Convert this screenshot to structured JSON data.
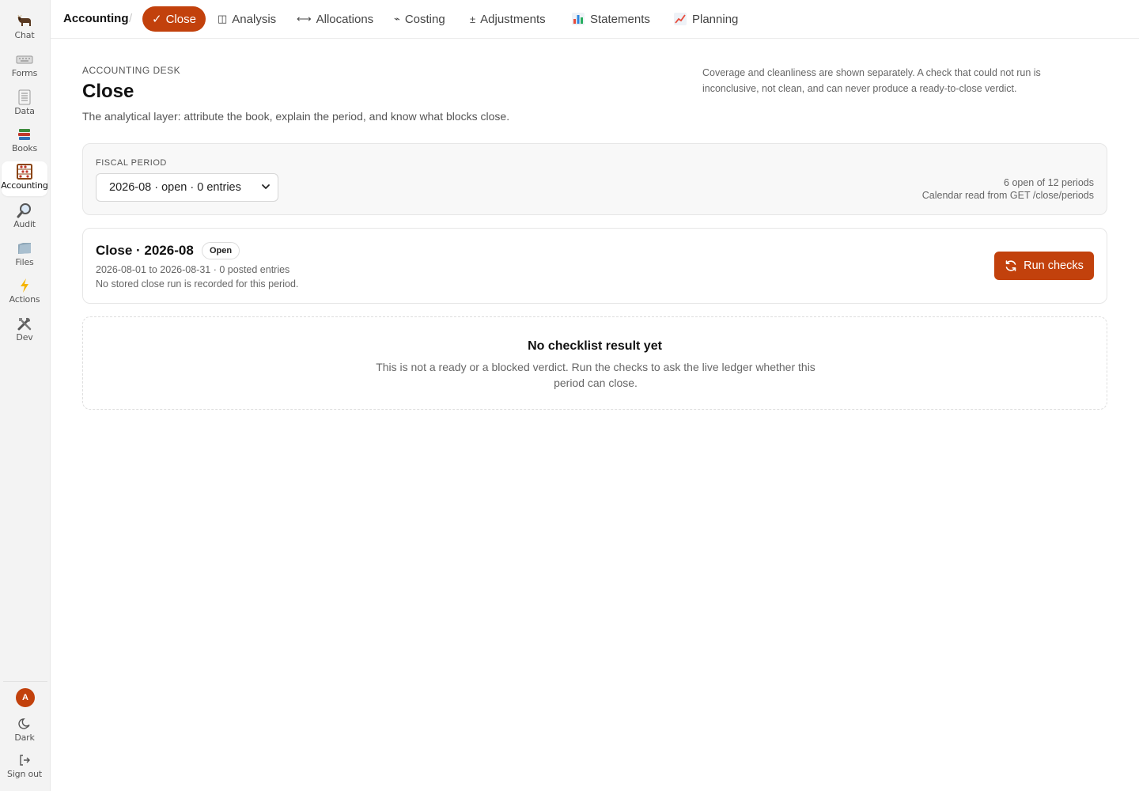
{
  "sidebar": {
    "items": [
      {
        "label": "Chat",
        "icon": "ox-icon"
      },
      {
        "label": "Forms",
        "icon": "keyboard-icon"
      },
      {
        "label": "Data",
        "icon": "spreadsheet-icon"
      },
      {
        "label": "Books",
        "icon": "books-icon"
      },
      {
        "label": "Accounting",
        "icon": "abacus-icon",
        "active": true
      },
      {
        "label": "Audit",
        "icon": "magnifier-icon"
      },
      {
        "label": "Files",
        "icon": "folder-icon"
      },
      {
        "label": "Actions",
        "icon": "lightning-icon"
      },
      {
        "label": "Dev",
        "icon": "tools-icon"
      }
    ],
    "avatar": "A",
    "dark_label": "Dark",
    "signout_label": "Sign out"
  },
  "topnav": {
    "breadcrumb": "Accounting",
    "separator": "/",
    "tabs": [
      {
        "label": "Close",
        "icon": "✓",
        "active": true
      },
      {
        "label": "Analysis",
        "icon": "◫"
      },
      {
        "label": "Allocations",
        "icon": "⟷"
      },
      {
        "label": "Costing",
        "icon": "⌁"
      },
      {
        "label": "Adjustments",
        "icon": "±"
      },
      {
        "label": "Statements",
        "icon": "bar-chart-icon"
      },
      {
        "label": "Planning",
        "icon": "line-chart-icon"
      }
    ]
  },
  "header": {
    "eyebrow": "Accounting Desk",
    "title": "Close",
    "subtitle": "The analytical layer: attribute the book, explain the period, and know what blocks close.",
    "note": "Coverage and cleanliness are shown separately. A check that could not run is inconclusive, not clean, and can never produce a ready-to-close verdict."
  },
  "fiscal": {
    "label": "Fiscal period",
    "selected": "2026-08 · open · 0 entries",
    "meta_count": "6 open of 12 periods",
    "meta_source": "Calendar read from GET /close/periods"
  },
  "close": {
    "title": "Close · 2026-08",
    "badge": "Open",
    "dates": "2026-08-01 to 2026-08-31 · 0 posted entries",
    "note": "No stored close run is recorded for this period.",
    "run_label": "Run checks"
  },
  "empty": {
    "title": "No checklist result yet",
    "text": "This is not a ready or a blocked verdict. Run the checks to ask the live ledger whether this period can close."
  },
  "colors": {
    "accent": "#c2410c",
    "sidebar_bg": "#f3f3f3"
  }
}
